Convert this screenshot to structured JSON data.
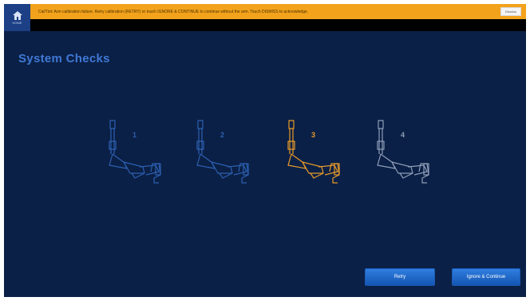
{
  "home": {
    "icon": "home-icon",
    "label": "HOME"
  },
  "alert": {
    "message": "Cal/Tint: Arm calibration failure. Retry calibration (RETRY) or touch IGNORE & CONTINUE to continue without the arm. Touch DISMISS to acknowledge.",
    "dismiss_label": "Dismiss",
    "color": "#f3a21b"
  },
  "page": {
    "title": "System Checks"
  },
  "arms": [
    {
      "number": "1",
      "color": "#2c5fb0",
      "icon": "robotic-arm-icon"
    },
    {
      "number": "2",
      "color": "#2c5fb0",
      "icon": "robotic-arm-icon"
    },
    {
      "number": "3",
      "color": "#e79a2a",
      "icon": "robotic-arm-icon"
    },
    {
      "number": "4",
      "color": "#8e9db8",
      "icon": "robotic-arm-icon"
    }
  ],
  "buttons": {
    "retry": "Retry",
    "ignore_continue": "Ignore & Continue"
  }
}
